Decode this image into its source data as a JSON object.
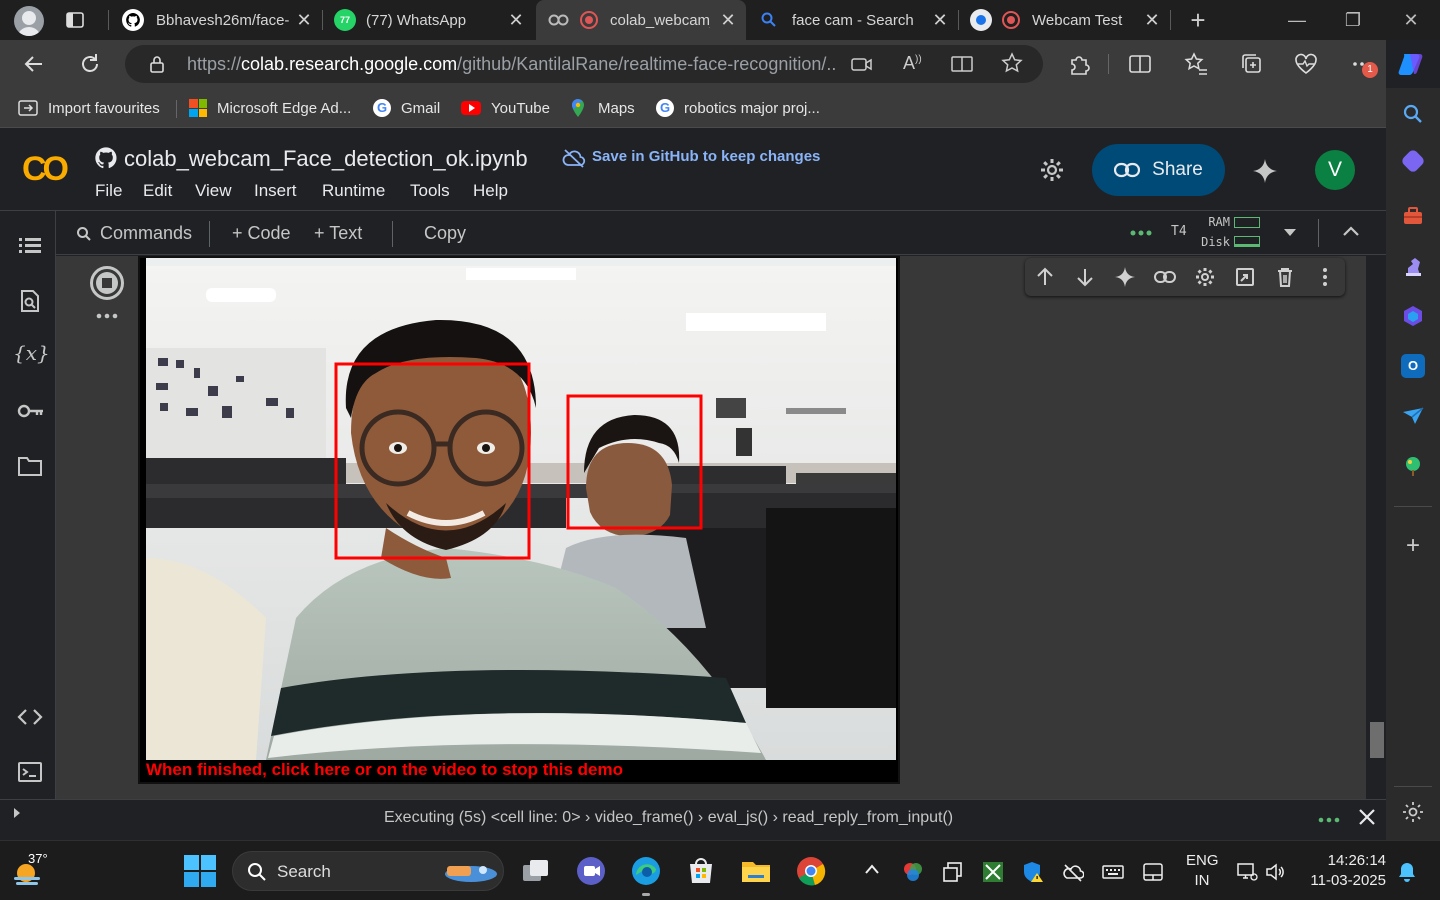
{
  "browser": {
    "tabs": [
      {
        "title": "Bbhavesh26m/face-"
      },
      {
        "title": "(77) WhatsApp",
        "badge": "77"
      },
      {
        "title": "colab_webcam_"
      },
      {
        "title": "face cam - Search"
      },
      {
        "title": "Webcam Test"
      }
    ],
    "url_scheme": "https://",
    "url_host": "colab.research.google.com",
    "url_path": "/github/KantilalRane/realtime-face-recognition/...",
    "notification_count": "1",
    "bookmarks": [
      {
        "label": "Import favourites"
      },
      {
        "label": "Microsoft Edge Ad..."
      },
      {
        "label": "Gmail"
      },
      {
        "label": "YouTube"
      },
      {
        "label": "Maps"
      },
      {
        "label": "robotics major proj..."
      }
    ]
  },
  "colab": {
    "logo": "CO",
    "notebook_title": "colab_webcam_Face_detection_ok.ipynb",
    "save_github": "Save in GitHub to keep changes",
    "menu": [
      "File",
      "Edit",
      "View",
      "Insert",
      "Runtime",
      "Tools",
      "Help"
    ],
    "share_label": "Share",
    "avatar_letter": "V",
    "toolbar": {
      "commands": "Commands",
      "code": "+ Code",
      "text": "+ Text",
      "copy": "Copy",
      "runtime_type": "T4",
      "ram_label": "RAM",
      "disk_label": "Disk"
    },
    "output_stop_text": "When finished, click here or on the video to stop this demo",
    "status": "Executing (5s)  <cell line: 0> › video_frame() › eval_js() › read_reply_from_input()"
  },
  "taskbar": {
    "weather_temp": "37°",
    "search_label": "Search",
    "lang_line1": "ENG",
    "lang_line2": "IN",
    "time": "14:26:14",
    "date": "11-03-2025"
  },
  "colors": {
    "accent_blue": "#8ab4f8",
    "share_bg": "#004a77",
    "avatar_bg": "#0b8043",
    "detect_box": "#ff0000"
  }
}
